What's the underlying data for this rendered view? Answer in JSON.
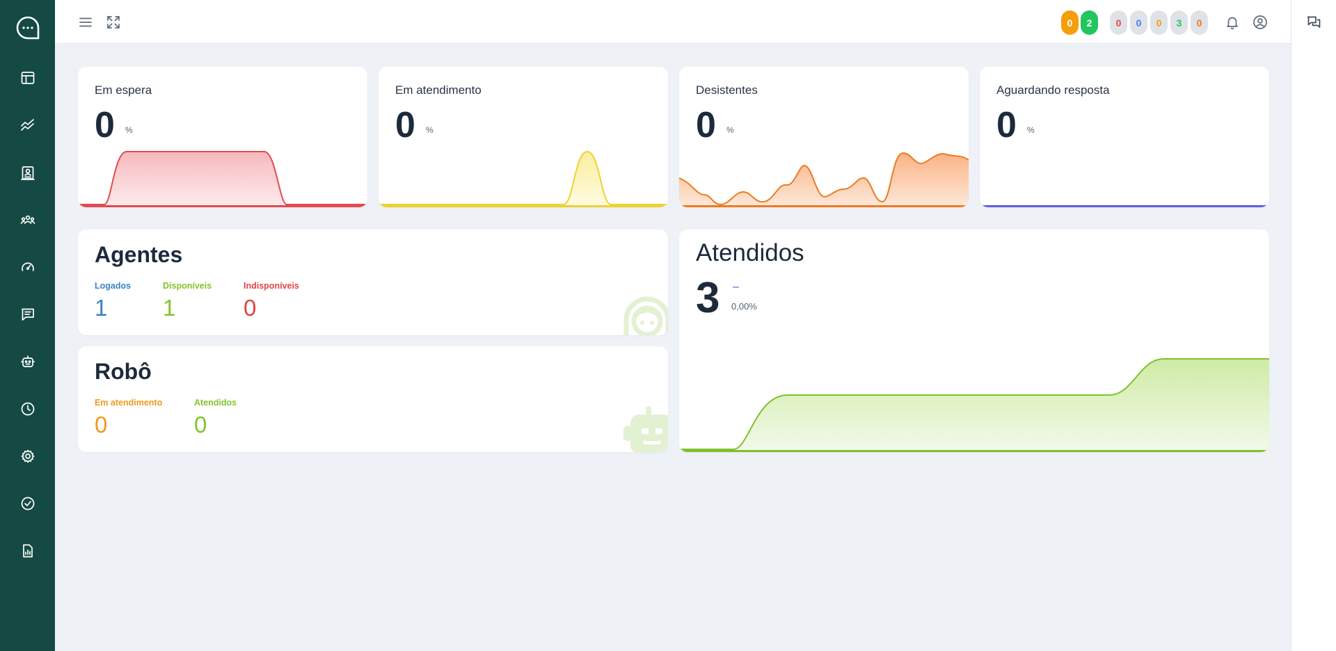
{
  "topbar": {
    "pills": [
      {
        "value": "0",
        "bg": "#f59e0b",
        "color": "#ffffff"
      },
      {
        "value": "2",
        "bg": "#22c55e",
        "color": "#ffffff"
      },
      {
        "value": "0",
        "bg": "#dfe3e8",
        "color": "#ef4444"
      },
      {
        "value": "0",
        "bg": "#dfe3e8",
        "color": "#3b82f6"
      },
      {
        "value": "0",
        "bg": "#dfe3e8",
        "color": "#f59e0b"
      },
      {
        "value": "3",
        "bg": "#dfe3e8",
        "color": "#22c55e"
      },
      {
        "value": "0",
        "bg": "#dfe3e8",
        "color": "#f97316"
      }
    ]
  },
  "stats": [
    {
      "title": "Em espera",
      "value": "0",
      "unit": "%",
      "color": "#e34a4f",
      "fill": "#f8c8cb"
    },
    {
      "title": "Em atendimento",
      "value": "0",
      "unit": "%",
      "color": "#eed22d",
      "fill": "#fbf1b6"
    },
    {
      "title": "Desistentes",
      "value": "0",
      "unit": "%",
      "color": "#ee7a1f",
      "fill": "#fbc8a1"
    },
    {
      "title": "Aguardando resposta",
      "value": "0",
      "unit": "%",
      "color": "#5b5fdb",
      "fill": "#dcdcf7"
    }
  ],
  "agentes": {
    "title": "Agentes",
    "items": [
      {
        "label": "Logados",
        "value": "1",
        "color": "#3b82c6"
      },
      {
        "label": "Disponíveis",
        "value": "1",
        "color": "#84c42b"
      },
      {
        "label": "Indisponíveis",
        "value": "0",
        "color": "#e04444"
      }
    ]
  },
  "robo": {
    "title": "Robô",
    "items": [
      {
        "label": "Em atendimento",
        "value": "0",
        "color": "#ef9a1b"
      },
      {
        "label": "Atendidos",
        "value": "0",
        "color": "#84c42b"
      }
    ]
  },
  "atendidos": {
    "title": "Atendidos",
    "value": "3",
    "trend": "–",
    "percent": "0,00%",
    "line_color": "#7ec12b",
    "fill_color": "#d6efb4"
  },
  "colors": {
    "sidebar_bg": "#154a44",
    "page_bg": "#eef2f7"
  },
  "icons": {
    "sidebar": [
      "chat-logo-icon",
      "dashboard-table-icon",
      "trend-lines-icon",
      "contact-card-icon",
      "team-icon",
      "speedometer-icon",
      "messages-icon",
      "robot-icon",
      "clock-icon",
      "gear-icon",
      "check-circle-icon",
      "report-icon"
    ],
    "topbar": [
      "menu-icon",
      "expand-icon",
      "bell-icon",
      "user-circle-icon"
    ],
    "right": [
      "chat-bubbles-icon"
    ]
  }
}
